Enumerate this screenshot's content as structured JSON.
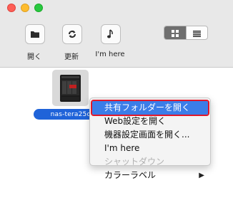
{
  "window": {
    "traffic_lights": {
      "close_color": "#fe5f57",
      "minimize_color": "#febc2e",
      "zoom_color": "#28c840"
    }
  },
  "toolbar": {
    "buttons": [
      {
        "label": "開く",
        "icon": "folder-icon"
      },
      {
        "label": "更新",
        "icon": "refresh-icon"
      },
      {
        "label": "I'm here",
        "icon": "music-note-icon"
      }
    ],
    "view_toggle": {
      "active": "grid",
      "options": [
        "grid-view-icon",
        "list-view-icon"
      ]
    }
  },
  "device": {
    "name": "nas-tera25d",
    "icon": "nas-device-icon"
  },
  "context_menu": {
    "items": [
      {
        "label": "共有フォルダーを開く",
        "state": "highlighted"
      },
      {
        "label": "Web設定を開く",
        "state": "enabled"
      },
      {
        "label": "機器設定画面を開く...",
        "state": "enabled"
      },
      {
        "label": "I'm here",
        "state": "enabled"
      },
      {
        "label": "シャットダウン",
        "state": "disabled"
      },
      {
        "label": "カラーラベル",
        "state": "enabled",
        "submenu": "▶"
      }
    ],
    "highlight_color": "#3b7de8",
    "annotation_color": "#e0172a"
  }
}
